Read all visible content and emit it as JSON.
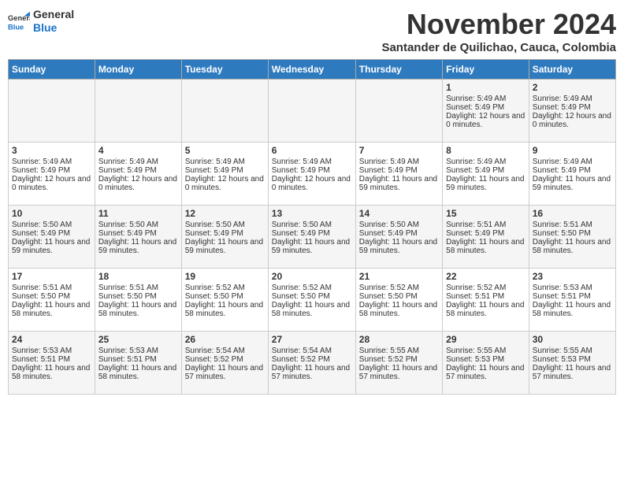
{
  "logo": {
    "line1": "General",
    "line2": "Blue"
  },
  "title": "November 2024",
  "location": "Santander de Quilichao, Cauca, Colombia",
  "weekdays": [
    "Sunday",
    "Monday",
    "Tuesday",
    "Wednesday",
    "Thursday",
    "Friday",
    "Saturday"
  ],
  "weeks": [
    [
      {
        "day": "",
        "info": ""
      },
      {
        "day": "",
        "info": ""
      },
      {
        "day": "",
        "info": ""
      },
      {
        "day": "",
        "info": ""
      },
      {
        "day": "",
        "info": ""
      },
      {
        "day": "1",
        "sunrise": "Sunrise: 5:49 AM",
        "sunset": "Sunset: 5:49 PM",
        "daylight": "Daylight: 12 hours and 0 minutes."
      },
      {
        "day": "2",
        "sunrise": "Sunrise: 5:49 AM",
        "sunset": "Sunset: 5:49 PM",
        "daylight": "Daylight: 12 hours and 0 minutes."
      }
    ],
    [
      {
        "day": "3",
        "sunrise": "Sunrise: 5:49 AM",
        "sunset": "Sunset: 5:49 PM",
        "daylight": "Daylight: 12 hours and 0 minutes."
      },
      {
        "day": "4",
        "sunrise": "Sunrise: 5:49 AM",
        "sunset": "Sunset: 5:49 PM",
        "daylight": "Daylight: 12 hours and 0 minutes."
      },
      {
        "day": "5",
        "sunrise": "Sunrise: 5:49 AM",
        "sunset": "Sunset: 5:49 PM",
        "daylight": "Daylight: 12 hours and 0 minutes."
      },
      {
        "day": "6",
        "sunrise": "Sunrise: 5:49 AM",
        "sunset": "Sunset: 5:49 PM",
        "daylight": "Daylight: 12 hours and 0 minutes."
      },
      {
        "day": "7",
        "sunrise": "Sunrise: 5:49 AM",
        "sunset": "Sunset: 5:49 PM",
        "daylight": "Daylight: 11 hours and 59 minutes."
      },
      {
        "day": "8",
        "sunrise": "Sunrise: 5:49 AM",
        "sunset": "Sunset: 5:49 PM",
        "daylight": "Daylight: 11 hours and 59 minutes."
      },
      {
        "day": "9",
        "sunrise": "Sunrise: 5:49 AM",
        "sunset": "Sunset: 5:49 PM",
        "daylight": "Daylight: 11 hours and 59 minutes."
      }
    ],
    [
      {
        "day": "10",
        "sunrise": "Sunrise: 5:50 AM",
        "sunset": "Sunset: 5:49 PM",
        "daylight": "Daylight: 11 hours and 59 minutes."
      },
      {
        "day": "11",
        "sunrise": "Sunrise: 5:50 AM",
        "sunset": "Sunset: 5:49 PM",
        "daylight": "Daylight: 11 hours and 59 minutes."
      },
      {
        "day": "12",
        "sunrise": "Sunrise: 5:50 AM",
        "sunset": "Sunset: 5:49 PM",
        "daylight": "Daylight: 11 hours and 59 minutes."
      },
      {
        "day": "13",
        "sunrise": "Sunrise: 5:50 AM",
        "sunset": "Sunset: 5:49 PM",
        "daylight": "Daylight: 11 hours and 59 minutes."
      },
      {
        "day": "14",
        "sunrise": "Sunrise: 5:50 AM",
        "sunset": "Sunset: 5:49 PM",
        "daylight": "Daylight: 11 hours and 59 minutes."
      },
      {
        "day": "15",
        "sunrise": "Sunrise: 5:51 AM",
        "sunset": "Sunset: 5:49 PM",
        "daylight": "Daylight: 11 hours and 58 minutes."
      },
      {
        "day": "16",
        "sunrise": "Sunrise: 5:51 AM",
        "sunset": "Sunset: 5:50 PM",
        "daylight": "Daylight: 11 hours and 58 minutes."
      }
    ],
    [
      {
        "day": "17",
        "sunrise": "Sunrise: 5:51 AM",
        "sunset": "Sunset: 5:50 PM",
        "daylight": "Daylight: 11 hours and 58 minutes."
      },
      {
        "day": "18",
        "sunrise": "Sunrise: 5:51 AM",
        "sunset": "Sunset: 5:50 PM",
        "daylight": "Daylight: 11 hours and 58 minutes."
      },
      {
        "day": "19",
        "sunrise": "Sunrise: 5:52 AM",
        "sunset": "Sunset: 5:50 PM",
        "daylight": "Daylight: 11 hours and 58 minutes."
      },
      {
        "day": "20",
        "sunrise": "Sunrise: 5:52 AM",
        "sunset": "Sunset: 5:50 PM",
        "daylight": "Daylight: 11 hours and 58 minutes."
      },
      {
        "day": "21",
        "sunrise": "Sunrise: 5:52 AM",
        "sunset": "Sunset: 5:50 PM",
        "daylight": "Daylight: 11 hours and 58 minutes."
      },
      {
        "day": "22",
        "sunrise": "Sunrise: 5:52 AM",
        "sunset": "Sunset: 5:51 PM",
        "daylight": "Daylight: 11 hours and 58 minutes."
      },
      {
        "day": "23",
        "sunrise": "Sunrise: 5:53 AM",
        "sunset": "Sunset: 5:51 PM",
        "daylight": "Daylight: 11 hours and 58 minutes."
      }
    ],
    [
      {
        "day": "24",
        "sunrise": "Sunrise: 5:53 AM",
        "sunset": "Sunset: 5:51 PM",
        "daylight": "Daylight: 11 hours and 58 minutes."
      },
      {
        "day": "25",
        "sunrise": "Sunrise: 5:53 AM",
        "sunset": "Sunset: 5:51 PM",
        "daylight": "Daylight: 11 hours and 58 minutes."
      },
      {
        "day": "26",
        "sunrise": "Sunrise: 5:54 AM",
        "sunset": "Sunset: 5:52 PM",
        "daylight": "Daylight: 11 hours and 57 minutes."
      },
      {
        "day": "27",
        "sunrise": "Sunrise: 5:54 AM",
        "sunset": "Sunset: 5:52 PM",
        "daylight": "Daylight: 11 hours and 57 minutes."
      },
      {
        "day": "28",
        "sunrise": "Sunrise: 5:55 AM",
        "sunset": "Sunset: 5:52 PM",
        "daylight": "Daylight: 11 hours and 57 minutes."
      },
      {
        "day": "29",
        "sunrise": "Sunrise: 5:55 AM",
        "sunset": "Sunset: 5:53 PM",
        "daylight": "Daylight: 11 hours and 57 minutes."
      },
      {
        "day": "30",
        "sunrise": "Sunrise: 5:55 AM",
        "sunset": "Sunset: 5:53 PM",
        "daylight": "Daylight: 11 hours and 57 minutes."
      }
    ]
  ]
}
